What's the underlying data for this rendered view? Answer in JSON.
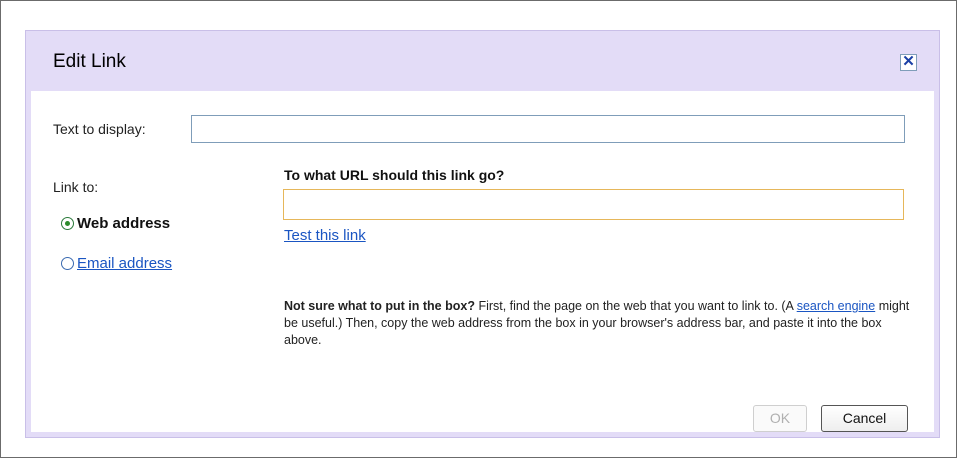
{
  "dialog": {
    "title": "Edit Link",
    "close_symbol": "✕",
    "close_icon": "close-icon"
  },
  "form": {
    "text_to_display_label": "Text to display:",
    "text_to_display_value": "",
    "link_to_label": "Link to:",
    "options": [
      {
        "label": "Web address",
        "selected": true
      },
      {
        "label": "Email address",
        "selected": false
      }
    ],
    "url_question": "To what URL should this link go?",
    "url_value": "",
    "test_link": "Test this link"
  },
  "help": {
    "bold": "Not sure what to put in the box?",
    "text_1": " First, find the page on the web that you want to link to. (A ",
    "link": "search engine",
    "text_2": " might be useful.) Then, copy the web address from the box in your browser's address bar, and paste it into the box above."
  },
  "buttons": {
    "ok": "OK",
    "cancel": "Cancel"
  },
  "colors": {
    "dialog_frame": "#e3dcf7",
    "link": "#1a55c2",
    "url_focus_border": "#e6b75a"
  }
}
